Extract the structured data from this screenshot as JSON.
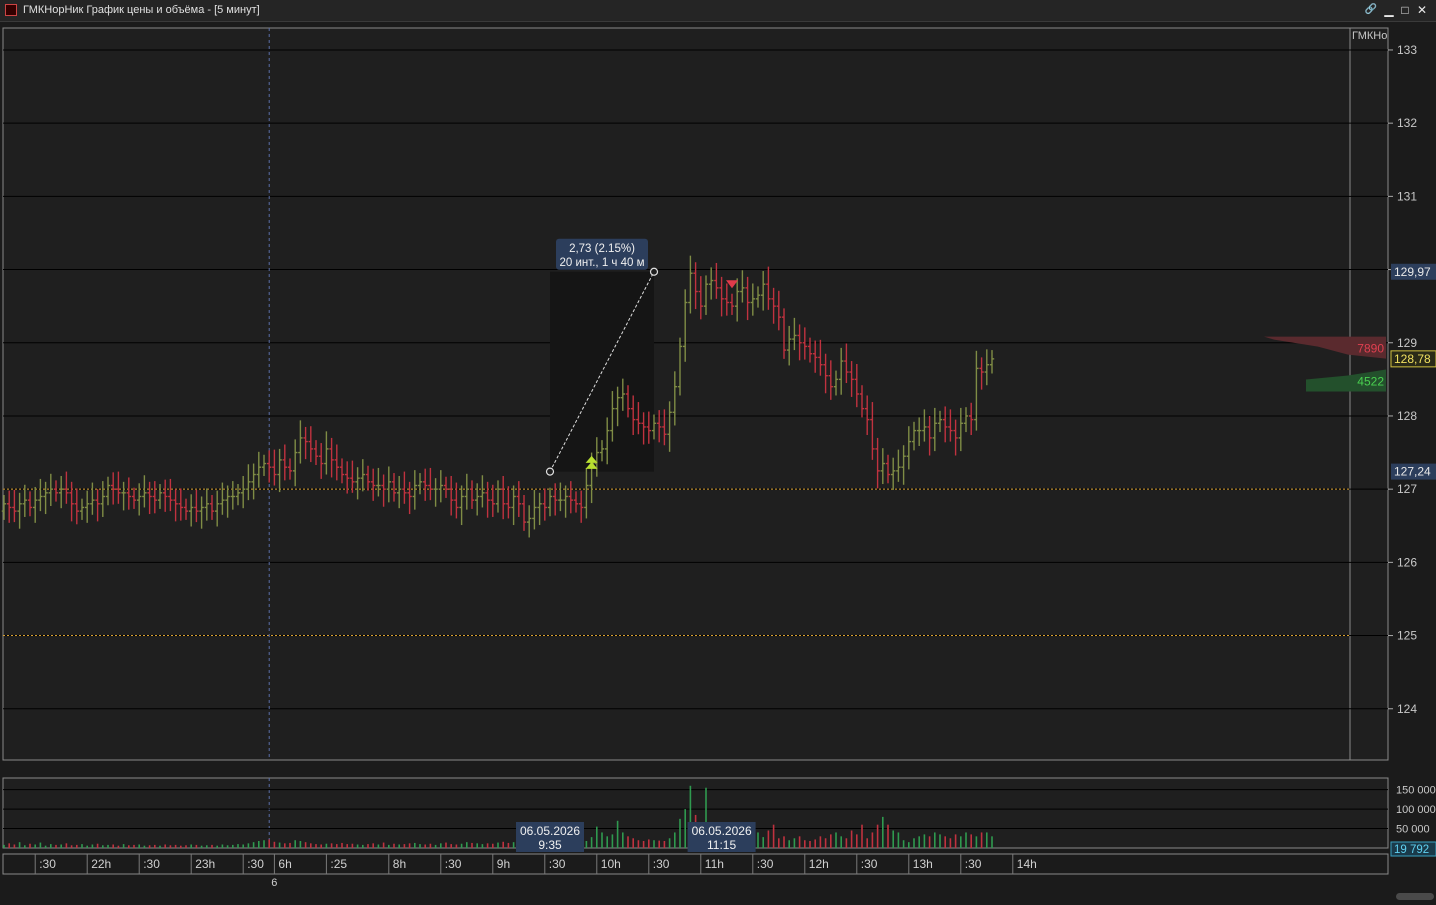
{
  "window": {
    "title": "ГМКНорНик График цены и объёма - [5 минут]",
    "buttons": [
      {
        "name": "link-icon",
        "glyph": "🔗"
      },
      {
        "name": "minimize-icon",
        "glyph": "▁"
      },
      {
        "name": "maximize-icon",
        "glyph": "□"
      },
      {
        "name": "close-icon",
        "glyph": "✕"
      }
    ]
  },
  "colors": {
    "up": "#7f8c45",
    "down": "#c0323f",
    "background": "#1b1b1b",
    "grid": "#000000",
    "dotted_line": "#d8a030",
    "label_bg": "#2c3e5c"
  },
  "chart_data": {
    "type": "ohlc-bar",
    "instrument_label": "ГМКНо",
    "price_axis": {
      "ylim": [
        123.3,
        133.3
      ],
      "ticks": [
        "124",
        "125",
        "126",
        "127",
        "128",
        "129",
        "130",
        "131",
        "132",
        "133"
      ],
      "tick_values": [
        124,
        125,
        126,
        127,
        128,
        129,
        130,
        131,
        132,
        133
      ],
      "markers": [
        {
          "label": "129,97",
          "value": 129.97,
          "bg": "#2c3e5c",
          "fg": "#e8e8e8"
        },
        {
          "label": "128,78",
          "value": 128.78,
          "bg": "#2a2a18",
          "fg": "#f0e060"
        },
        {
          "label": "127,24",
          "value": 127.24,
          "bg": "#2c3e5c",
          "fg": "#e8e8e8"
        }
      ]
    },
    "horizontal_levels": [
      127.0,
      125.0
    ],
    "measure": {
      "from": {
        "x": 105,
        "y": 127.24
      },
      "to": {
        "x": 125,
        "y": 129.97
      },
      "label_line1": "2,73 (2.15%)",
      "label_line2": "20 инт., 1 ч 40 м"
    },
    "signals": [
      {
        "x": 113,
        "type": "buy",
        "value": 127.4
      },
      {
        "x": 140,
        "type": "sell",
        "value": 129.8
      }
    ],
    "volume_profile": [
      {
        "label": "7890",
        "value": 128.92,
        "side": "sell"
      },
      {
        "label": "4522",
        "value": 128.47,
        "side": "buy"
      }
    ],
    "volume_axis": {
      "ticks": [
        "150 000",
        "100 000",
        "50 000"
      ],
      "tick_values": [
        150000,
        100000,
        50000
      ],
      "ylim": [
        0,
        180000
      ],
      "current_label": "19 792"
    },
    "date_labels": [
      {
        "x": 105,
        "date": "06.05.2026",
        "time": "9:35"
      },
      {
        "x": 138,
        "date": "06.05.2026",
        "time": "11:15"
      }
    ],
    "time_axis": {
      "ticks": [
        {
          "x": 6,
          "label": ":30"
        },
        {
          "x": 16,
          "label": "22h"
        },
        {
          "x": 26,
          "label": ":30"
        },
        {
          "x": 36,
          "label": "23h"
        },
        {
          "x": 46,
          "label": ":30"
        },
        {
          "x": 52,
          "label": "6h"
        },
        {
          "x": 62,
          "label": ":25"
        },
        {
          "x": 74,
          "label": "8h"
        },
        {
          "x": 84,
          "label": ":30"
        },
        {
          "x": 94,
          "label": "9h"
        },
        {
          "x": 104,
          "label": ":30"
        },
        {
          "x": 114,
          "label": "10h"
        },
        {
          "x": 124,
          "label": ":30"
        },
        {
          "x": 134,
          "label": "11h"
        },
        {
          "x": 144,
          "label": ":30"
        },
        {
          "x": 154,
          "label": "12h"
        },
        {
          "x": 164,
          "label": ":30"
        },
        {
          "x": 174,
          "label": "13h"
        },
        {
          "x": 184,
          "label": ":30"
        },
        {
          "x": 194,
          "label": "14h"
        }
      ],
      "session_divider_x": 51,
      "session_label": "6"
    },
    "close": [
      126.8,
      126.75,
      126.7,
      126.8,
      126.85,
      126.75,
      126.85,
      126.9,
      126.95,
      127.0,
      126.95,
      127.0,
      126.95,
      126.8,
      126.7,
      126.75,
      126.8,
      126.85,
      126.8,
      126.9,
      127.05,
      127.0,
      126.95,
      126.95,
      126.9,
      126.85,
      126.9,
      126.95,
      126.9,
      126.85,
      126.95,
      126.9,
      126.85,
      126.8,
      126.75,
      126.7,
      126.75,
      126.7,
      126.75,
      126.8,
      126.7,
      126.8,
      126.85,
      126.9,
      126.9,
      126.95,
      127.0,
      127.1,
      127.2,
      127.3,
      127.35,
      127.3,
      127.2,
      127.4,
      127.3,
      127.25,
      127.5,
      127.7,
      127.65,
      127.55,
      127.45,
      127.35,
      127.55,
      127.4,
      127.3,
      127.2,
      127.15,
      127.1,
      127.15,
      127.2,
      127.1,
      127.05,
      127.05,
      127.0,
      127.1,
      126.95,
      127.0,
      126.95,
      126.9,
      127.05,
      127.1,
      127.05,
      127.0,
      127.0,
      127.05,
      127.0,
      126.85,
      126.75,
      126.9,
      127.0,
      126.85,
      126.9,
      126.95,
      126.85,
      126.8,
      127.0,
      126.8,
      126.75,
      126.9,
      126.8,
      126.55,
      126.6,
      126.75,
      126.8,
      126.75,
      126.9,
      126.85,
      126.85,
      126.9,
      126.85,
      126.8,
      126.75,
      127.05,
      127.35,
      127.5,
      127.55,
      127.8,
      128.1,
      128.25,
      128.3,
      128.1,
      127.95,
      127.9,
      127.85,
      127.8,
      127.9,
      127.85,
      127.75,
      128.05,
      128.4,
      128.95,
      129.55,
      129.95,
      129.7,
      129.5,
      129.8,
      129.85,
      129.75,
      129.6,
      129.55,
      129.5,
      129.7,
      129.75,
      129.55,
      129.6,
      129.65,
      129.8,
      129.6,
      129.5,
      129.35,
      128.9,
      129.05,
      129.1,
      129.0,
      128.95,
      128.85,
      128.8,
      128.7,
      128.55,
      128.4,
      128.5,
      128.75,
      128.6,
      128.5,
      128.3,
      128.1,
      127.95,
      127.55,
      127.25,
      127.35,
      127.2,
      127.25,
      127.3,
      127.45,
      127.65,
      127.8,
      127.8,
      127.85,
      127.7,
      127.9,
      127.95,
      127.85,
      127.8,
      127.7,
      127.9,
      128.0,
      127.95,
      128.65,
      128.6,
      128.7,
      128.78
    ],
    "open": [
      126.7,
      126.8,
      126.75,
      126.7,
      126.8,
      126.85,
      126.75,
      126.85,
      126.9,
      126.95,
      127.0,
      126.95,
      127.0,
      126.95,
      126.8,
      126.7,
      126.75,
      126.8,
      126.85,
      126.8,
      126.9,
      127.05,
      127.0,
      126.95,
      126.95,
      126.9,
      126.85,
      126.9,
      126.95,
      126.9,
      126.85,
      126.95,
      126.9,
      126.85,
      126.8,
      126.75,
      126.7,
      126.75,
      126.7,
      126.75,
      126.8,
      126.7,
      126.8,
      126.85,
      126.9,
      126.9,
      126.95,
      127.0,
      127.1,
      127.2,
      127.3,
      127.35,
      127.3,
      127.2,
      127.4,
      127.3,
      127.25,
      127.5,
      127.7,
      127.65,
      127.55,
      127.45,
      127.35,
      127.55,
      127.4,
      127.3,
      127.2,
      127.15,
      127.1,
      127.15,
      127.2,
      127.1,
      127.05,
      127.05,
      127.0,
      127.1,
      126.95,
      127.0,
      126.95,
      126.9,
      127.05,
      127.1,
      127.05,
      127.0,
      127.0,
      127.05,
      127.0,
      126.85,
      126.75,
      126.9,
      127.0,
      126.85,
      126.9,
      126.95,
      126.85,
      126.8,
      127.0,
      126.8,
      126.75,
      126.9,
      126.8,
      126.55,
      126.6,
      126.75,
      126.8,
      126.75,
      126.9,
      126.85,
      126.85,
      126.9,
      126.85,
      126.8,
      126.75,
      127.05,
      127.35,
      127.5,
      127.55,
      127.8,
      128.1,
      128.25,
      128.3,
      128.1,
      127.95,
      127.9,
      127.85,
      127.8,
      127.9,
      127.85,
      127.75,
      128.05,
      128.4,
      128.95,
      129.55,
      129.95,
      129.7,
      129.5,
      129.8,
      129.85,
      129.75,
      129.6,
      129.55,
      129.5,
      129.7,
      129.75,
      129.55,
      129.6,
      129.65,
      129.8,
      129.6,
      129.5,
      129.35,
      128.9,
      129.05,
      129.1,
      129.0,
      128.95,
      128.85,
      128.8,
      128.7,
      128.55,
      128.4,
      128.5,
      128.75,
      128.6,
      128.5,
      128.3,
      128.1,
      127.95,
      127.55,
      127.25,
      127.35,
      127.2,
      127.25,
      127.3,
      127.45,
      127.65,
      127.8,
      127.8,
      127.85,
      127.7,
      127.9,
      127.95,
      127.85,
      127.8,
      127.7,
      127.9,
      128.0,
      127.95,
      128.65,
      128.6,
      128.7
    ],
    "volume": [
      8000,
      12000,
      9000,
      15000,
      7000,
      11000,
      9000,
      14000,
      6000,
      10000,
      8000,
      9000,
      12000,
      7000,
      8000,
      10000,
      6000,
      9000,
      11000,
      7000,
      8000,
      9000,
      6000,
      10000,
      7000,
      8000,
      9000,
      6000,
      7000,
      8000,
      6000,
      9000,
      7000,
      8000,
      6000,
      7000,
      9000,
      8000,
      6000,
      7000,
      8000,
      6000,
      9000,
      7000,
      8000,
      10000,
      9000,
      12000,
      15000,
      18000,
      20000,
      22000,
      16000,
      14000,
      12000,
      13000,
      20000,
      18000,
      15000,
      12000,
      10000,
      9000,
      11000,
      12000,
      10000,
      13000,
      10000,
      11000,
      9000,
      8000,
      10000,
      12000,
      9000,
      14000,
      8000,
      11000,
      9000,
      10000,
      12000,
      13000,
      10000,
      9000,
      11000,
      8000,
      12000,
      14000,
      10000,
      9000,
      11000,
      15000,
      13000,
      12000,
      10000,
      12000,
      11000,
      14000,
      16000,
      13000,
      15000,
      12000,
      14000,
      15000,
      13000,
      18000,
      14000,
      16000,
      18000,
      12000,
      15000,
      13000,
      14000,
      16000,
      18000,
      28000,
      55000,
      40000,
      30000,
      35000,
      70000,
      40000,
      30000,
      25000,
      20000,
      18000,
      22000,
      20000,
      19000,
      18000,
      25000,
      40000,
      75000,
      100000,
      160000,
      85000,
      40000,
      155000,
      60000,
      45000,
      35000,
      30000,
      25000,
      20000,
      25000,
      22000,
      35000,
      40000,
      28000,
      45000,
      60000,
      25000,
      30000,
      20000,
      25000,
      30000,
      20000,
      18000,
      22000,
      30000,
      25000,
      35000,
      40000,
      30000,
      25000,
      45000,
      35000,
      60000,
      25000,
      40000,
      60000,
      80000,
      60000,
      45000,
      40000,
      20000,
      15000,
      25000,
      30000,
      35000,
      30000,
      40000,
      35000,
      30000,
      25000,
      35000,
      30000,
      40000,
      35000,
      30000,
      40000,
      40000,
      30000,
      20000
    ]
  }
}
